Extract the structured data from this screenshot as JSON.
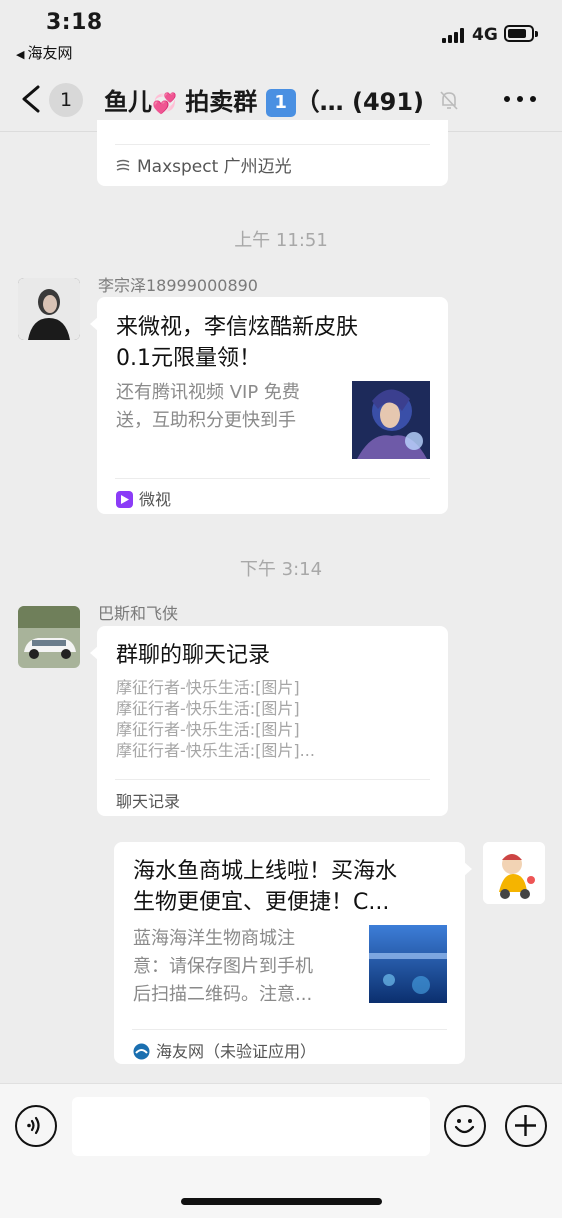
{
  "status_bar": {
    "time": "3:18",
    "back_app": "海友网",
    "network": "4G",
    "signal_bars": 4,
    "battery_level": 0.7
  },
  "navbar": {
    "badge_count": "1",
    "title_prefix": "鱼儿",
    "title_heart": "💞",
    "title_mid": " 拍卖群",
    "title_keycap": "1",
    "title_suffix": "（… (491)",
    "icons": [
      "back-chevron-icon",
      "mute-bell-icon",
      "more-dots-icon"
    ]
  },
  "messages": {
    "top_card": {
      "source": "Maxspect 广州迈光"
    },
    "timestamp_1": "上午 11:51",
    "msg1": {
      "sender": "李宗泽18999000890",
      "title": "来微视，李信炫酷新皮肤0.1元限量领！",
      "title_line1": "来微视，李信炫酷新皮肤",
      "title_line2": "0.1元限量领！",
      "desc_line1": "还有腾讯视频 VIP 免费",
      "desc_line2": "送，互助积分更快到手",
      "source": "微视"
    },
    "timestamp_2": "下午 3:14",
    "msg2": {
      "sender": "巴斯和飞侠",
      "title": "群聊的聊天记录",
      "lines": [
        "摩征行者-快乐生活:[图片]",
        "摩征行者-快乐生活:[图片]",
        "摩征行者-快乐生活:[图片]",
        "摩征行者-快乐生活:[图片]..."
      ],
      "footer": "聊天记录"
    },
    "msg3": {
      "title_line1": "海水鱼商城上线啦！买海水",
      "title_line2": "生物更便宜、更便捷！C...",
      "desc_line1": "蓝海海洋生物商城注",
      "desc_line2": "意：请保存图片到手机",
      "desc_line3": "后扫描二维码。注意...",
      "source": "海友网（未验证应用）"
    }
  },
  "input_bar": {
    "placeholder": "",
    "icons": [
      "voice-icon",
      "emoji-icon",
      "plus-icon"
    ]
  },
  "colors": {
    "background": "#ededed",
    "card": "#ffffff",
    "timestamp": "#a8a8a8",
    "weishi_brand": "#8b3cf7",
    "haiyou_brand": "#1a6fb0"
  }
}
